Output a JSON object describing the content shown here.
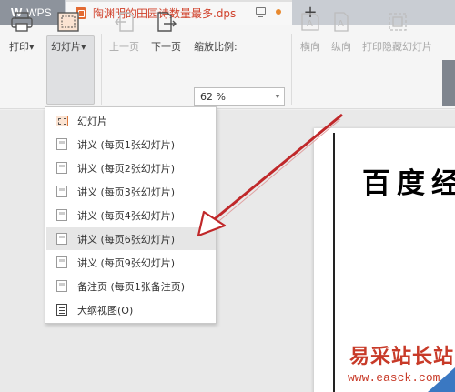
{
  "tabs": {
    "app_tab": "WPS",
    "app_logo": "W",
    "document_tab": "陶渊明的田园诗数量最多.dps",
    "new_tab": "+"
  },
  "ribbon": {
    "print": "打印",
    "slides": "幻灯片",
    "prev_page": "上一页",
    "next_page": "下一页",
    "zoom_label": "缩放比例:",
    "zoom_value": "62 %",
    "landscape": "横向",
    "portrait": "纵向",
    "print_hidden_slides": "打印隐藏幻灯片"
  },
  "dropdown_arrow": "▾",
  "menu": {
    "items": [
      {
        "label": "幻灯片"
      },
      {
        "label": "讲义 (每页1张幻灯片)"
      },
      {
        "label": "讲义 (每页2张幻灯片)"
      },
      {
        "label": "讲义 (每页3张幻灯片)"
      },
      {
        "label": "讲义 (每页4张幻灯片)"
      },
      {
        "label": "讲义 (每页6张幻灯片)"
      },
      {
        "label": "讲义 (每页9张幻灯片)"
      },
      {
        "label": "备注页 (每页1张备注页)"
      },
      {
        "label": "大纲视图(O)"
      }
    ],
    "highlighted_index": 5
  },
  "slide": {
    "title_fragment": "百度经"
  },
  "watermark": {
    "site_name": "易采站长站",
    "url": "www.easck.com"
  },
  "colors": {
    "document_tab_text": "#d0402a",
    "arrow": "#c0282a",
    "watermark": "#c83a28",
    "wps_tab": "#8d939c"
  }
}
